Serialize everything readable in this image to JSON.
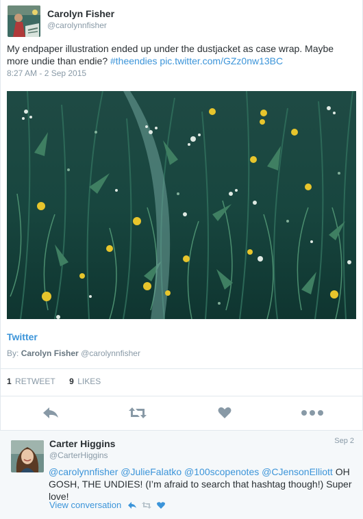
{
  "tweet": {
    "author_name": "Carolyn Fisher",
    "author_handle": "@carolynnfisher",
    "text_main": "My endpaper illustration ended up under the dustjacket as case wrap. Maybe more undie than endie? ",
    "hashtag": "#theendies",
    "pic_link": "pic.twitter.com/GZz0nw13BC",
    "timestamp": "8:27 AM - 2 Sep 2015",
    "source_name": "Twitter",
    "by_label": "By:",
    "by_author": "Carolyn Fisher",
    "by_handle": "@carolynnfisher",
    "retweet_count": "1",
    "retweet_label": "RETWEET",
    "likes_count": "9",
    "likes_label": "LIKES"
  },
  "icons": {
    "reply": "reply-icon",
    "retweet": "retweet-icon",
    "like": "heart-icon",
    "more": "more-icon"
  },
  "reply": {
    "author_name": "Carter Higgins",
    "author_handle": "@CarterHiggins",
    "date": "Sep 2",
    "mentions": "@carolynnfisher @JulieFalatko @100scopenotes @CJensonElliott",
    "text_rest": " OH GOSH, THE UNDIES! (I’m afraid to search that hashtag though!) Super love!",
    "view_conversation": "View conversation"
  },
  "colors": {
    "link": "#3b94d9",
    "text": "#292f33",
    "muted": "#8899a6",
    "icon": "#8899a6",
    "background": "#e6ecf0"
  }
}
